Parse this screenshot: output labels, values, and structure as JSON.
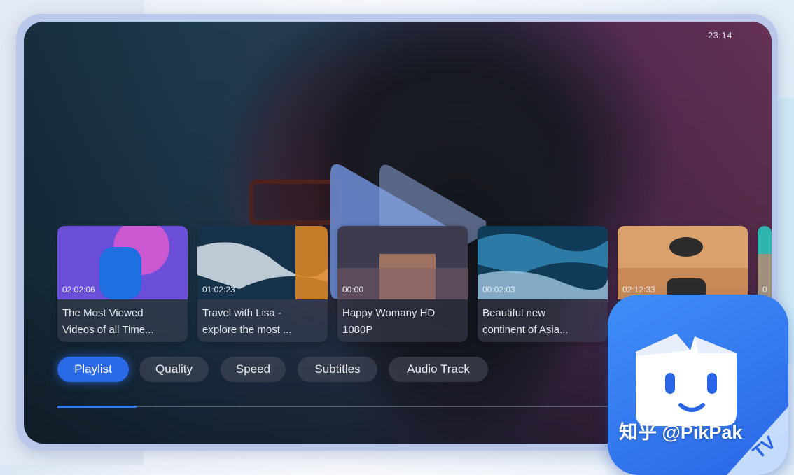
{
  "status": {
    "time": "23:14"
  },
  "playlist": [
    {
      "duration": "02:02:06",
      "title_line1": "The Most Viewed",
      "title_line2": "Videos of all Time...",
      "thumb_colors": [
        "#6b4fd8",
        "#e25ad0",
        "#1f6fe0"
      ]
    },
    {
      "duration": "01:02:23",
      "title_line1": "Travel with Lisa -",
      "title_line2": "explore the most ...",
      "thumb_colors": [
        "#15324a",
        "#cfd9e3",
        "#e38a22"
      ]
    },
    {
      "duration": "00:00",
      "title_line1": "Happy Womany HD",
      "title_line2": "1080P",
      "thumb_colors": [
        "#3d3a4e",
        "#c98c6a",
        "#7a5c68"
      ]
    },
    {
      "duration": "00:02:03",
      "title_line1": "Beautiful new",
      "title_line2": "continent of Asia...",
      "thumb_colors": [
        "#0f3b58",
        "#2e7aa6",
        "#9fc7e0"
      ]
    },
    {
      "duration": "02:12:33",
      "title_line1": "",
      "title_line2": "",
      "thumb_colors": [
        "#c98a57",
        "#e7b07c",
        "#2b2b2b"
      ]
    },
    {
      "duration": "0",
      "title_line1": "",
      "title_line2": "",
      "thumb_colors": [
        "#2fb5b0",
        "#ef7a5a",
        "#2c7fc8"
      ]
    }
  ],
  "tabs": [
    {
      "label": "Playlist",
      "active": true
    },
    {
      "label": "Quality",
      "active": false
    },
    {
      "label": "Speed",
      "active": false
    },
    {
      "label": "Subtitles",
      "active": false
    },
    {
      "label": "Audio Track",
      "active": false
    }
  ],
  "progress": {
    "fraction": 0.14
  },
  "badge": {
    "tv_label": "TV"
  },
  "watermark": {
    "text": "知乎 @PikPak"
  },
  "colors": {
    "accent": "#2a6ae6",
    "frame": "#b9c8ea",
    "app_icon": "#3478f0"
  }
}
